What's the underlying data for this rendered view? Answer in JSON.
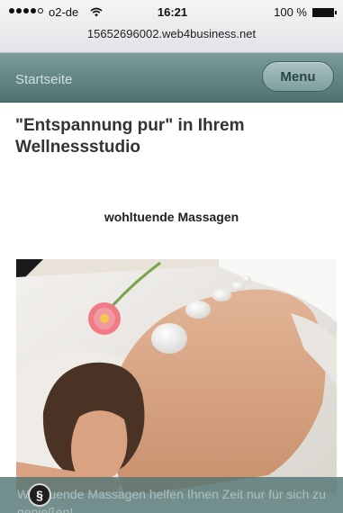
{
  "status_bar": {
    "carrier": "o2-de",
    "time": "16:21",
    "battery": "100 %",
    "url": "15652696002.web4business.net"
  },
  "header": {
    "home_label": "Startseite",
    "menu_label": "Menu"
  },
  "main": {
    "title": "\"Entspannung pur\" in Ihrem Wellnessstudio",
    "subheading": "wohltuende Massagen",
    "footer_text": "Wohltuende Massagen helfen Ihnen Zeit nur für sich zu genießen!"
  },
  "footer": {
    "legal_symbol": "§"
  },
  "icons": {
    "signal": "signal-strength-icon",
    "wifi": "wifi-icon",
    "battery": "battery-icon",
    "legal": "paragraph-icon"
  },
  "colors": {
    "header": "#5e8381",
    "menu_button": "#93b3b1",
    "footer": "#547674"
  }
}
